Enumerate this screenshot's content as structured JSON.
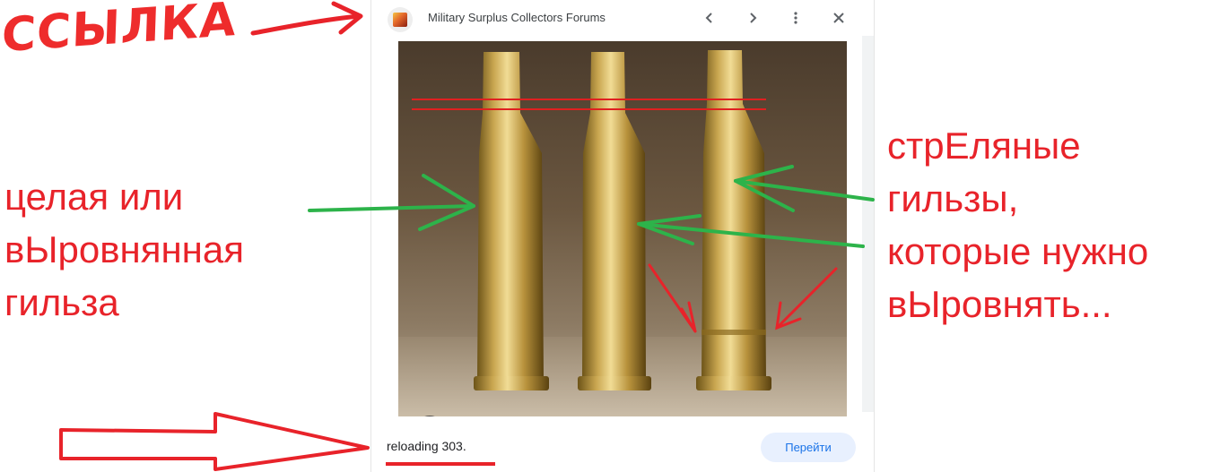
{
  "annotations": {
    "link_label": "ССЫЛКА",
    "left_note": [
      "целая или",
      "вЫровнянная",
      "гильза"
    ],
    "right_note": [
      "стрЕляные",
      "гильзы,",
      "которые нужно",
      "вЫровнять..."
    ]
  },
  "panel": {
    "site_name": "Military Surplus Collectors Forums",
    "caption": "reloading 303.",
    "go_button": "Перейти"
  },
  "icons": {
    "favicon": "site-favicon",
    "prev": "chevron-left-icon",
    "next": "chevron-right-icon",
    "more": "more-vert-icon",
    "close": "close-icon",
    "lens": "google-lens-icon"
  },
  "colors": {
    "annotation_red": "#e8232a",
    "annotation_green": "#2db34a",
    "button_bg": "#e8f0fe",
    "button_text": "#1a73e8"
  }
}
